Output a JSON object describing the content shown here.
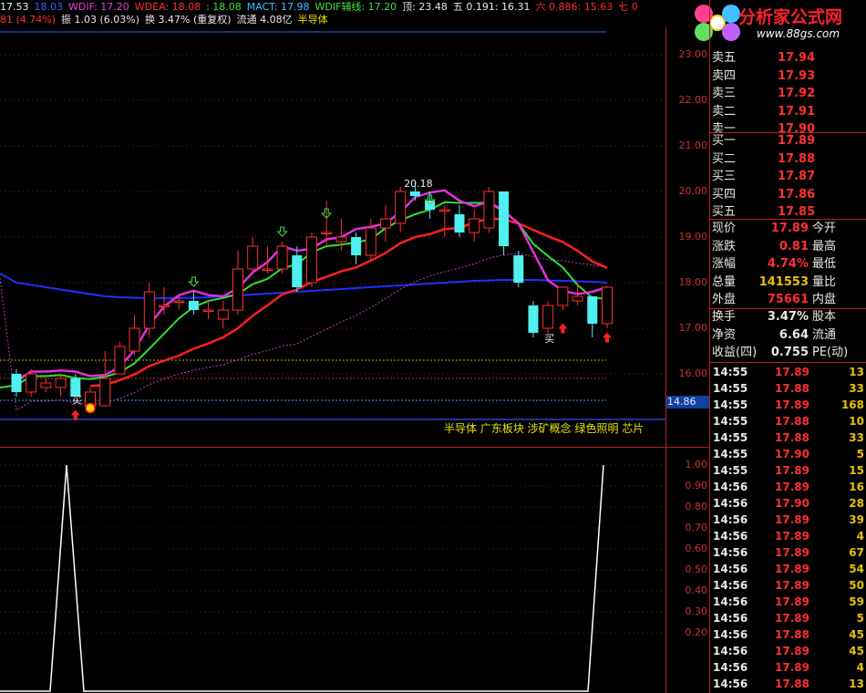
{
  "header": {
    "line1": [
      {
        "text": "17.53",
        "color": "#e8e8e8"
      },
      {
        "text": "18.03",
        "color": "#4060ff"
      },
      {
        "text": "WDIF: 17.20",
        "color": "#e040e0"
      },
      {
        "text": "WDEA: 18.08",
        "color": "#ff3030"
      },
      {
        "text": ": 18.08",
        "color": "#40e040"
      },
      {
        "text": "MACT: 17.98",
        "color": "#40c0ff"
      },
      {
        "text": "WDIF辅线: 17.20",
        "color": "#40e040"
      },
      {
        "text": "顶: 23.48",
        "color": "#e8e8e8"
      },
      {
        "text": "五 0.191: 16.31",
        "color": "#e8e8e8"
      },
      {
        "text": "六 0.886: 15.63",
        "color": "#ff3030"
      },
      {
        "text": "七 0",
        "color": "#ff3030"
      }
    ],
    "line2": [
      {
        "text": "81 (4.74%)",
        "color": "#ff3030"
      },
      {
        "text": "振 1.03 (6.03%)",
        "color": "#e8e8e8"
      },
      {
        "text": "换 3.47% (重复权)",
        "color": "#e8e8e8"
      },
      {
        "text": "流通 4.08亿",
        "color": "#e8e8e8"
      },
      {
        "text": "半导体",
        "color": "#e8e000"
      }
    ]
  },
  "logo": {
    "text": "分析家公式网",
    "url": "www.88gs.com"
  },
  "price_axis": [
    "23.00",
    "22.00",
    "21.00",
    "20.00",
    "19.00",
    "18.00",
    "17.00",
    "16.00"
  ],
  "price_tag": "14.86",
  "ind_axis": [
    "1.00",
    "0.90",
    "0.80",
    "0.70",
    "0.60",
    "0.50",
    "0.40",
    "0.30",
    "0.20"
  ],
  "annotations": {
    "peak": "20.18",
    "buy1": "买",
    "buy2": "买"
  },
  "concepts": "半导体 广东板块 涉矿概念 绿色照明 芯片",
  "quote": {
    "asks": [
      {
        "label": "卖五",
        "price": "17.94"
      },
      {
        "label": "卖四",
        "price": "17.93"
      },
      {
        "label": "卖三",
        "price": "17.92"
      },
      {
        "label": "卖二",
        "price": "17.91"
      },
      {
        "label": "卖一",
        "price": "17.90"
      }
    ],
    "bids": [
      {
        "label": "买一",
        "price": "17.89"
      },
      {
        "label": "买二",
        "price": "17.88"
      },
      {
        "label": "买三",
        "price": "17.87"
      },
      {
        "label": "买四",
        "price": "17.86"
      },
      {
        "label": "买五",
        "price": "17.85"
      }
    ],
    "stats": [
      {
        "label": "现价",
        "value": "17.89",
        "label2": "今开",
        "color": "#ff3030"
      },
      {
        "label": "涨跌",
        "value": "0.81",
        "label2": "最高",
        "color": "#ff3030"
      },
      {
        "label": "涨幅",
        "value": "4.74%",
        "label2": "最低",
        "color": "#ff3030"
      },
      {
        "label": "总量",
        "value": "141553",
        "label2": "量比",
        "color": "#e8c000"
      },
      {
        "label": "外盘",
        "value": "75661",
        "label2": "内盘",
        "color": "#ff3030"
      }
    ],
    "stats2": [
      {
        "label": "换手",
        "value": "3.47%",
        "label2": "股本"
      },
      {
        "label": "净资",
        "value": "6.64",
        "label2": "流通"
      },
      {
        "label": "收益(四)",
        "value": "0.755",
        "label2": "PE(动)"
      }
    ]
  },
  "ticks": [
    {
      "t": "14:55",
      "p": "17.89",
      "v": "13",
      "c": "#ff3030"
    },
    {
      "t": "14:55",
      "p": "17.88",
      "v": "33",
      "c": "#ff3030"
    },
    {
      "t": "14:55",
      "p": "17.89",
      "v": "168",
      "c": "#ff3030"
    },
    {
      "t": "14:55",
      "p": "17.88",
      "v": "10",
      "c": "#ff3030"
    },
    {
      "t": "14:55",
      "p": "17.88",
      "v": "33",
      "c": "#ff3030"
    },
    {
      "t": "14:55",
      "p": "17.90",
      "v": "5",
      "c": "#ff3030"
    },
    {
      "t": "14:55",
      "p": "17.89",
      "v": "15",
      "c": "#ff3030"
    },
    {
      "t": "14:56",
      "p": "17.89",
      "v": "16",
      "c": "#ff3030"
    },
    {
      "t": "14:56",
      "p": "17.90",
      "v": "28",
      "c": "#ff3030"
    },
    {
      "t": "14:56",
      "p": "17.89",
      "v": "39",
      "c": "#ff3030"
    },
    {
      "t": "14:56",
      "p": "17.89",
      "v": "4",
      "c": "#ff3030"
    },
    {
      "t": "14:56",
      "p": "17.89",
      "v": "67",
      "c": "#ff3030"
    },
    {
      "t": "14:56",
      "p": "17.89",
      "v": "54",
      "c": "#ff3030"
    },
    {
      "t": "14:56",
      "p": "17.89",
      "v": "50",
      "c": "#ff3030"
    },
    {
      "t": "14:56",
      "p": "17.89",
      "v": "59",
      "c": "#ff3030"
    },
    {
      "t": "14:56",
      "p": "17.89",
      "v": "5",
      "c": "#ff3030"
    },
    {
      "t": "14:56",
      "p": "17.88",
      "v": "45",
      "c": "#ff3030"
    },
    {
      "t": "14:56",
      "p": "17.89",
      "v": "45",
      "c": "#ff3030"
    },
    {
      "t": "14:56",
      "p": "17.89",
      "v": "4",
      "c": "#ff3030"
    },
    {
      "t": "14:56",
      "p": "17.88",
      "v": "13",
      "c": "#ff3030"
    }
  ],
  "candles": [
    {
      "o": 16.0,
      "c": 15.6,
      "h": 16.1,
      "l": 15.5
    },
    {
      "o": 15.6,
      "c": 16.0,
      "h": 16.1,
      "l": 15.5
    },
    {
      "o": 15.7,
      "c": 15.8,
      "h": 15.9,
      "l": 15.6
    },
    {
      "o": 15.7,
      "c": 15.9,
      "h": 16.0,
      "l": 15.5
    },
    {
      "o": 15.9,
      "c": 15.5,
      "h": 16.0,
      "l": 15.5
    },
    {
      "o": 15.3,
      "c": 15.6,
      "h": 15.7,
      "l": 15.3
    },
    {
      "o": 15.3,
      "c": 15.9,
      "h": 16.5,
      "l": 15.3
    },
    {
      "o": 16.0,
      "c": 16.6,
      "h": 16.7,
      "l": 16.0
    },
    {
      "o": 16.5,
      "c": 17.0,
      "h": 17.3,
      "l": 16.4
    },
    {
      "o": 17.0,
      "c": 17.8,
      "h": 18.0,
      "l": 16.8
    },
    {
      "o": 17.5,
      "c": 17.5,
      "h": 17.9,
      "l": 17.3
    },
    {
      "o": 17.6,
      "c": 17.6,
      "h": 17.7,
      "l": 17.4
    },
    {
      "o": 17.6,
      "c": 17.4,
      "h": 17.8,
      "l": 17.3
    },
    {
      "o": 17.4,
      "c": 17.4,
      "h": 17.6,
      "l": 17.2
    },
    {
      "o": 17.2,
      "c": 17.4,
      "h": 17.6,
      "l": 17.0
    },
    {
      "o": 17.4,
      "c": 18.3,
      "h": 18.7,
      "l": 17.3
    },
    {
      "o": 18.3,
      "c": 18.8,
      "h": 19.0,
      "l": 18.2
    },
    {
      "o": 18.3,
      "c": 18.3,
      "h": 18.8,
      "l": 18.2
    },
    {
      "o": 18.3,
      "c": 18.8,
      "h": 18.9,
      "l": 18.2
    },
    {
      "o": 18.6,
      "c": 17.9,
      "h": 18.8,
      "l": 17.8
    },
    {
      "o": 18.0,
      "c": 19.0,
      "h": 19.1,
      "l": 17.9
    },
    {
      "o": 19.1,
      "c": 19.1,
      "h": 19.8,
      "l": 18.8
    },
    {
      "o": 18.9,
      "c": 19.0,
      "h": 19.4,
      "l": 18.7
    },
    {
      "o": 19.0,
      "c": 18.6,
      "h": 19.1,
      "l": 18.4
    },
    {
      "o": 18.6,
      "c": 19.2,
      "h": 19.4,
      "l": 18.5
    },
    {
      "o": 19.2,
      "c": 19.4,
      "h": 19.7,
      "l": 18.9
    },
    {
      "o": 19.3,
      "c": 20.0,
      "h": 20.1,
      "l": 19.1
    },
    {
      "o": 20.0,
      "c": 19.9,
      "h": 20.2,
      "l": 19.8
    },
    {
      "o": 19.8,
      "c": 19.6,
      "h": 20.0,
      "l": 19.4
    },
    {
      "o": 19.6,
      "c": 19.6,
      "h": 19.7,
      "l": 19.0
    },
    {
      "o": 19.5,
      "c": 19.1,
      "h": 19.7,
      "l": 19.0
    },
    {
      "o": 19.1,
      "c": 19.4,
      "h": 19.6,
      "l": 18.9
    },
    {
      "o": 19.2,
      "c": 20.0,
      "h": 20.1,
      "l": 19.1
    },
    {
      "o": 20.0,
      "c": 18.8,
      "h": 20.0,
      "l": 18.6
    },
    {
      "o": 18.6,
      "c": 18.0,
      "h": 18.7,
      "l": 17.9
    },
    {
      "o": 17.5,
      "c": 16.9,
      "h": 17.6,
      "l": 16.8
    },
    {
      "o": 17.0,
      "c": 17.5,
      "h": 17.6,
      "l": 16.9
    },
    {
      "o": 17.5,
      "c": 17.9,
      "h": 17.9,
      "l": 17.4
    },
    {
      "o": 17.6,
      "c": 17.7,
      "h": 18.0,
      "l": 17.5
    },
    {
      "o": 17.7,
      "c": 17.1,
      "h": 17.7,
      "l": 16.8
    },
    {
      "o": 17.1,
      "c": 17.9,
      "h": 17.9,
      "l": 17.0
    }
  ],
  "signal": [
    0,
    0,
    0,
    0,
    0,
    0,
    0,
    0,
    0,
    0,
    1,
    0,
    0,
    0,
    0,
    0,
    0,
    0,
    0,
    0,
    0,
    0,
    0,
    0,
    0,
    0,
    0,
    0,
    0,
    0,
    0,
    0,
    0,
    0,
    0,
    0,
    0,
    0,
    0,
    0,
    0,
    0,
    0,
    0,
    0,
    0,
    0,
    0,
    0,
    0,
    0,
    0,
    0,
    0,
    0,
    0,
    0,
    0,
    0,
    0,
    0,
    0,
    0,
    0,
    0,
    0,
    0,
    0,
    0,
    0,
    0,
    0,
    0,
    0,
    0,
    0,
    0,
    0,
    0,
    0,
    0,
    0,
    0,
    0,
    0,
    0,
    0,
    0,
    0,
    0,
    1
  ]
}
